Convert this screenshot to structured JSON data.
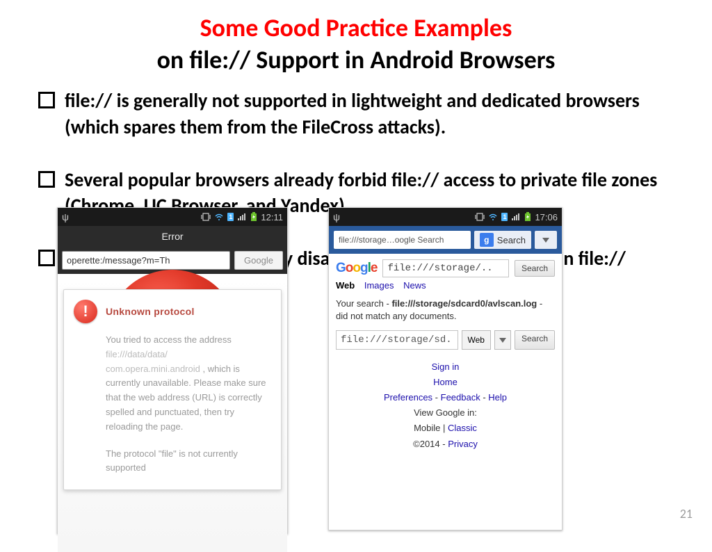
{
  "title": {
    "red": "Some Good Practice Examples",
    "black": "on file:// Support in Android Browsers"
  },
  "bullets": [
    "file:// is generally not supported in lightweight and dedicated browsers (which spares them from the FileCross attacks).",
    "Several popular browsers already forbid file:// access to private file zones\n(Chrome, UC Browser, and Yandex).",
    "Three browsers also actively disable the JavaScript execution in file:// URLs."
  ],
  "page_number": "21",
  "phone1": {
    "status_time": "12:11",
    "header": "Error",
    "url_value": "operette:/message?m=Th",
    "google_btn": "Google",
    "err_title": "Unknown protocol",
    "msg_intro": "You tried to access the address",
    "msg_url_line1": "file:///data/data/",
    "msg_url_line2": "com.opera.mini.android",
    "msg_rest": " , which is currently unavailable.  Please make sure that the web address (URL) is correctly spelled and punctuated, then try reloading the page.",
    "msg2": "The protocol \"file\" is not currently supported"
  },
  "phone2": {
    "status_time": "17:06",
    "url_value": "file:///storage…oogle Search",
    "search_label": "Search",
    "search_input": "file:///storage/..",
    "search_btn": "Search",
    "tab_web": "Web",
    "tab_images": "Images",
    "tab_news": "News",
    "result_pre": "Your search - ",
    "result_query": "file:///storage/sdcard0/avlscan.log",
    "result_post": " - did not match any documents.",
    "second_input": "file:///storage/sd.",
    "sel_web": "Web",
    "signin": "Sign in",
    "home": "Home",
    "prefs": "Preferences",
    "feedback": "Feedback",
    "help": "Help",
    "viewin": "View Google in:",
    "mobile": "Mobile",
    "classic": "Classic",
    "copyright": "©2014 -",
    "privacy": "Privacy"
  }
}
